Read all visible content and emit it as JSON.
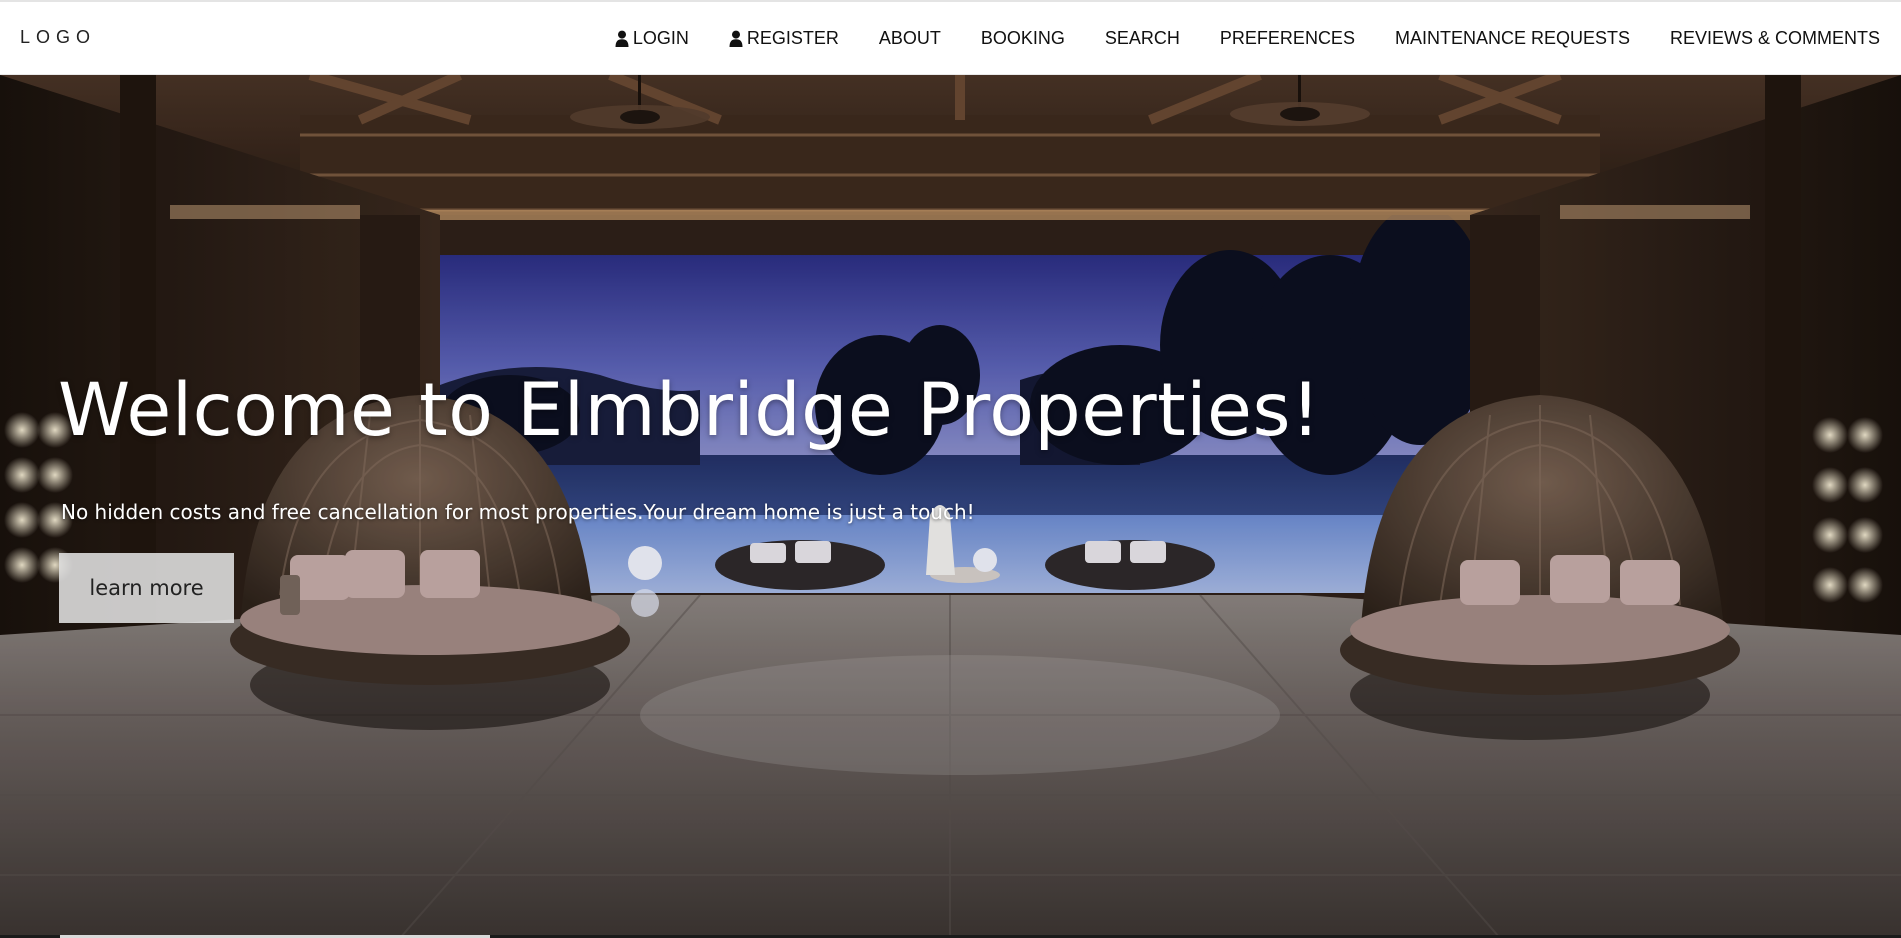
{
  "header": {
    "logo": "LOGO",
    "nav": [
      {
        "label": "LOGIN",
        "icon": "user-icon"
      },
      {
        "label": "REGISTER",
        "icon": "user-icon"
      },
      {
        "label": "ABOUT"
      },
      {
        "label": "BOOKING"
      },
      {
        "label": "SEARCH"
      },
      {
        "label": "PREFERENCES"
      },
      {
        "label": "MAINTENANCE REQUESTS"
      },
      {
        "label": "REVIEWS & COMMENTS"
      }
    ]
  },
  "hero": {
    "title": "Welcome to Elmbridge Properties!",
    "subtitle": "No hidden costs and free cancellation for most properties.Your dream home is just a touch!",
    "button_label": "learn more"
  },
  "colors": {
    "nav_background": "#ffffff",
    "nav_text": "#111111",
    "hero_text": "#ffffff",
    "button_background": "#e1e1e1"
  }
}
